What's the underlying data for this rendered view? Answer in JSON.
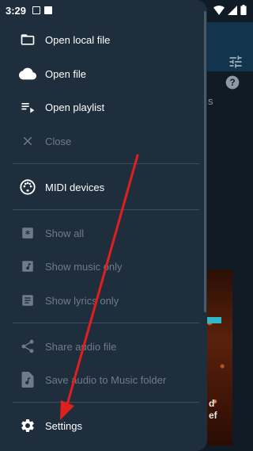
{
  "status_bar": {
    "time": "3:29"
  },
  "background": {
    "partial_text": "s",
    "art_text_line1": "d",
    "art_text_line2": "ef"
  },
  "drawer": {
    "items": [
      {
        "label": "Open local file",
        "icon": "folder-open-icon",
        "enabled": true
      },
      {
        "label": "Open file",
        "icon": "cloud-icon",
        "enabled": true
      },
      {
        "label": "Open playlist",
        "icon": "playlist-icon",
        "enabled": true
      },
      {
        "label": "Close",
        "icon": "close-icon",
        "enabled": false
      },
      {
        "label": "MIDI devices",
        "icon": "midi-icon",
        "enabled": true
      },
      {
        "label": "Show all",
        "icon": "asterisk-icon",
        "enabled": false
      },
      {
        "label": "Show music only",
        "icon": "music-note-icon",
        "enabled": false
      },
      {
        "label": "Show lyrics only",
        "icon": "lyrics-icon",
        "enabled": false
      },
      {
        "label": "Share audio file",
        "icon": "share-icon",
        "enabled": false
      },
      {
        "label": "Save audio to Music folder",
        "icon": "music-file-icon",
        "enabled": false
      },
      {
        "label": "Settings",
        "icon": "gear-icon",
        "enabled": true
      }
    ]
  },
  "colors": {
    "drawer_bg": "#1f2e3d",
    "toolbar": "#12344d",
    "annotation_arrow": "#e01f1f",
    "disabled_text": "#6f7c88"
  }
}
